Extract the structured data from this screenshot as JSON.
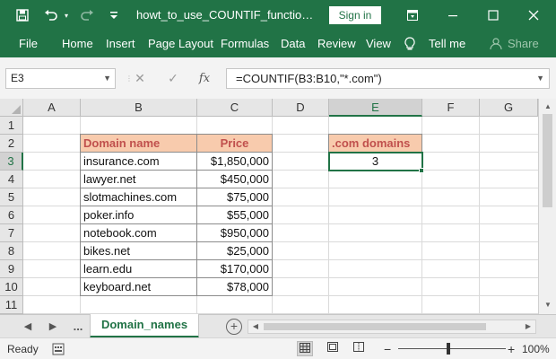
{
  "title": {
    "filename": "howt_to_use_COUNTIF_function.xlsx...",
    "sign_in": "Sign in",
    "icons": [
      "save-icon",
      "undo-icon",
      "redo-icon",
      "customize-qat-icon",
      "ribbon-display-icon",
      "minimize-icon",
      "maximize-icon",
      "close-icon"
    ],
    "brand_color": "#217346"
  },
  "menu": {
    "file": "File",
    "home": "Home",
    "insert": "Insert",
    "page_layout": "Page Layout",
    "formulas": "Formulas",
    "data": "Data",
    "review": "Review",
    "view": "View",
    "tell_me": "Tell me",
    "share": "Share"
  },
  "formula_bar": {
    "name_box": "E3",
    "formula": "=COUNTIF(B3:B10,\"*.com\")",
    "cancel": "✕",
    "enter": "✓",
    "fx": "fx"
  },
  "grid": {
    "columns": [
      "A",
      "B",
      "C",
      "D",
      "E",
      "F",
      "G"
    ],
    "rows": [
      "1",
      "2",
      "3",
      "4",
      "5",
      "6",
      "7",
      "8",
      "9",
      "10",
      "11"
    ],
    "selected_column": "E",
    "selected_row": "3"
  },
  "table": {
    "header": {
      "domain": "Domain name",
      "price": "Price"
    },
    "rows": [
      {
        "domain": "insurance.com",
        "price": "$1,850,000"
      },
      {
        "domain": "lawyer.net",
        "price": "$450,000"
      },
      {
        "domain": "slotmachines.com",
        "price": "$75,000"
      },
      {
        "domain": "poker.info",
        "price": "$55,000"
      },
      {
        "domain": "notebook.com",
        "price": "$950,000"
      },
      {
        "domain": "bikes.net",
        "price": "$25,000"
      },
      {
        "domain": "learn.edu",
        "price": "$170,000"
      },
      {
        "domain": "keyboard.net",
        "price": "$78,000"
      }
    ],
    "header_fill": "#f8cbad",
    "header_text_color": "#c0504d"
  },
  "result": {
    "label": ".com domains",
    "value": "3"
  },
  "sheet": {
    "ellipsis": "...",
    "active_tab": "Domain_names",
    "add_symbol": "+"
  },
  "status": {
    "ready": "Ready",
    "zoom_minus": "−",
    "zoom_plus": "+",
    "zoom": "100%"
  }
}
